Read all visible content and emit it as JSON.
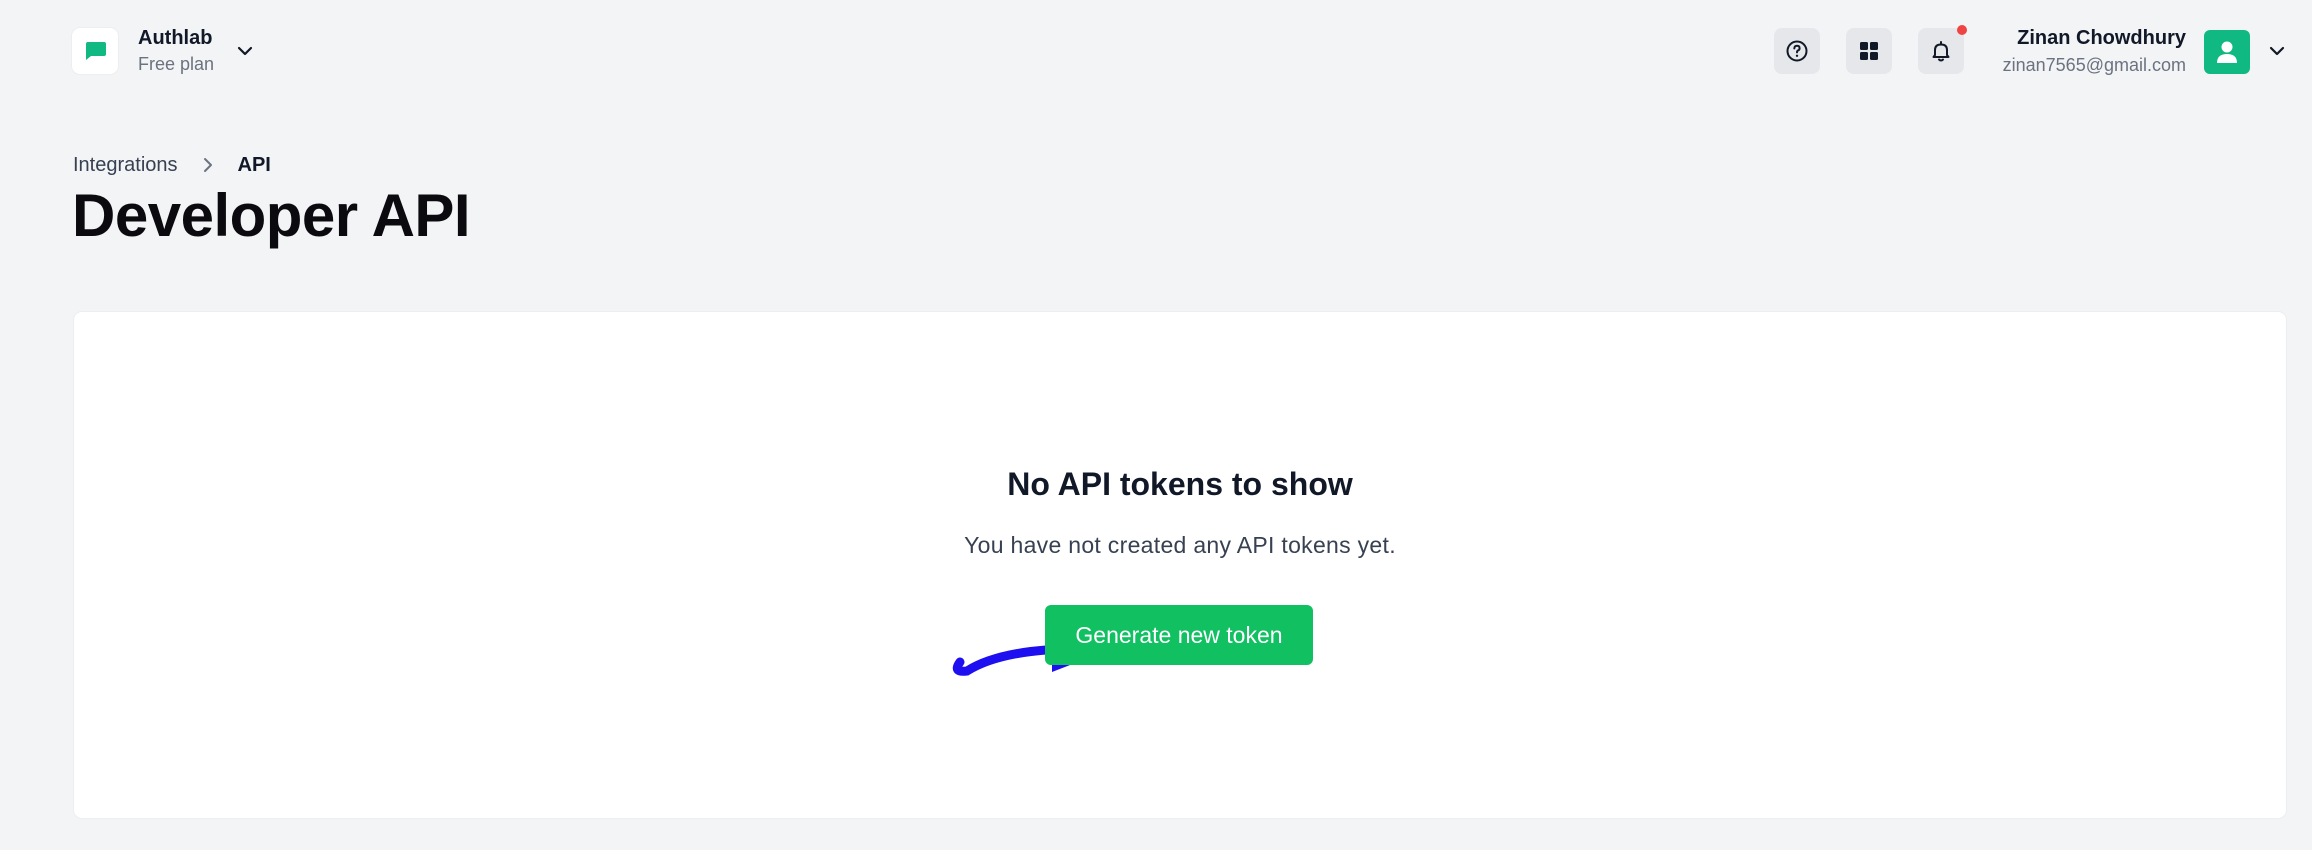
{
  "workspace": {
    "name": "Authlab",
    "plan": "Free plan"
  },
  "header": {
    "help_icon": "help-circle-icon",
    "apps_icon": "grid-icon",
    "notifications_icon": "bell-icon",
    "has_unread_notifications": true
  },
  "user": {
    "name": "Zinan Chowdhury",
    "email": "zinan7565@gmail.com"
  },
  "breadcrumb": {
    "parent": "Integrations",
    "current": "API"
  },
  "page": {
    "title": "Developer API"
  },
  "empty_state": {
    "title": "No API tokens to show",
    "subtitle": "You have not created any API tokens yet.",
    "button_label": "Generate new token"
  },
  "colors": {
    "brand_green": "#10c061",
    "notification_red": "#ef4444",
    "annotation_blue": "#1d0ff0"
  }
}
